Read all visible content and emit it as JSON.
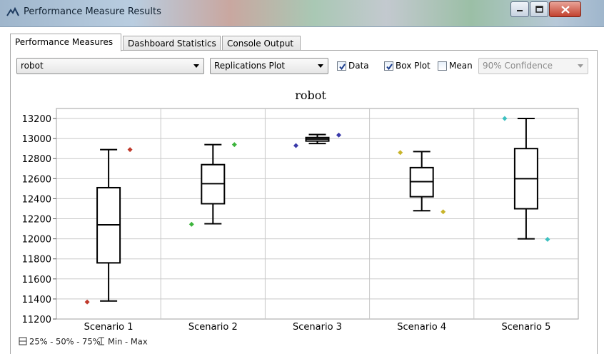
{
  "window": {
    "title": "Performance Measure Results",
    "icon": "tent-chart-icon"
  },
  "tabs": [
    {
      "label": "Performance Measures",
      "active": true
    },
    {
      "label": "Dashboard Statistics",
      "active": false
    },
    {
      "label": "Console Output",
      "active": false
    }
  ],
  "toolbar": {
    "series_select": "robot",
    "plot_type_select": "Replications Plot",
    "data_checkbox": {
      "label": "Data",
      "checked": true
    },
    "boxplot_checkbox": {
      "label": "Box Plot",
      "checked": true
    },
    "mean_checkbox": {
      "label": "Mean",
      "checked": false
    },
    "confidence_select": "90% Confidence",
    "confidence_enabled": false
  },
  "chart_data": {
    "type": "box",
    "title": "robot",
    "xlabel": "",
    "ylabel": "",
    "ylim": [
      11200,
      13300
    ],
    "yticks": [
      11200,
      11400,
      11600,
      11800,
      12000,
      12200,
      12400,
      12600,
      12800,
      13000,
      13200
    ],
    "grid": true,
    "categories": [
      "Scenario 1",
      "Scenario 2",
      "Scenario 3",
      "Scenario 4",
      "Scenario 5"
    ],
    "boxes": [
      {
        "category": "Scenario 1",
        "min": 11380,
        "q1": 11760,
        "median": 12140,
        "q3": 12510,
        "max": 12890,
        "color": "#c0392b",
        "points_left": [
          11370
        ],
        "points_right": [
          12890
        ]
      },
      {
        "category": "Scenario 2",
        "min": 12150,
        "q1": 12350,
        "median": 12550,
        "q3": 12740,
        "max": 12940,
        "color": "#3cb43c",
        "points_left": [
          12145
        ],
        "points_right": [
          12940
        ]
      },
      {
        "category": "Scenario 3",
        "min": 12950,
        "q1": 12975,
        "median": 12995,
        "q3": 13010,
        "max": 13040,
        "color": "#3a3aaa",
        "points_left": [
          12930
        ],
        "points_right": [
          13035
        ]
      },
      {
        "category": "Scenario 4",
        "min": 12280,
        "q1": 12420,
        "median": 12570,
        "q3": 12710,
        "max": 12870,
        "color": "#c8b42a",
        "points_left": [
          12860
        ],
        "points_right": [
          12270
        ]
      },
      {
        "category": "Scenario 5",
        "min": 12000,
        "q1": 12300,
        "median": 12600,
        "q3": 12900,
        "max": 13200,
        "color": "#3cc0c0",
        "points_left": [
          13200
        ],
        "points_right": [
          11995
        ]
      }
    ],
    "legend": [
      {
        "icon": "box-icon",
        "label": "25% - 50% - 75%"
      },
      {
        "icon": "whisker-icon",
        "label": "Min - Max"
      }
    ]
  }
}
